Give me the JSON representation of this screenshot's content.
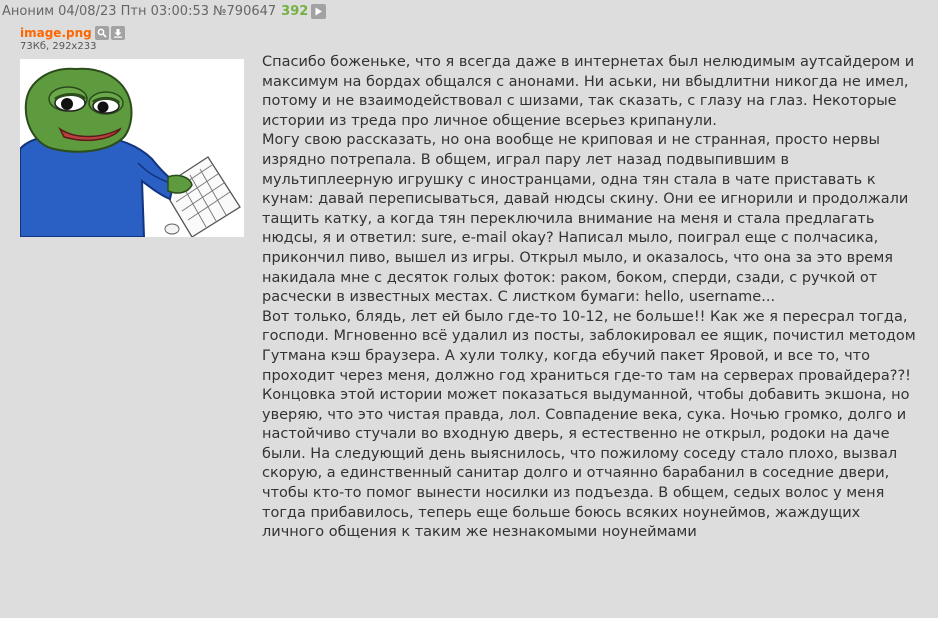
{
  "post": {
    "author": "Аноним",
    "date": "04/08/23 Птн 03:00:53",
    "number": "№790647",
    "replies": "392",
    "file": {
      "name": "image.png",
      "meta": "73Кб, 292x233",
      "thumb_alt": ""
    },
    "lines": [
      "Спасибо боженьке, что я всегда даже в интернетах был нелюдимым аутсайдером и",
      "максимум на бордах общался с анонами. Ни аськи, ни вбыдлитни никогда не имел,",
      "потому и не взаимодействовал с шизами, так сказать, с глазу на глаз. Некоторые",
      "истории из треда про личное общение всерьез крипанули.",
      "Могу свою рассказать, но она вообще не криповая и не странная, просто нервы",
      "изрядно потрепала. В общем, играл пару лет назад подвыпившим в",
      "мультиплеерную игрушку с иностранцами, одна тян стала в чате приставать к",
      "кунам: давай переписываться, давай нюдсы скину. Они ее игнорили и продолжали",
      "тащить катку, а когда тян переключила внимание на меня и стала предлагать",
      "нюдсы, я и ответил: sure, e-mail okay? Написал мыло, поиграл еще с полчасика,",
      "прикончил пиво, вышел из игры. Открыл мыло, и оказалось, что она за это время",
      "накидала мне с десяток голых фоток: раком, боком, сперди, сзади, с ручкой от",
      "расчески в известных местах. С листком бумаги: hello, username...",
      "Вот только, блядь, лет ей было где-то 10-12, не больше!! Как же я пересрал тогда,",
      "господи. Мгновенно всё удалил из посты, заблокировал ее ящик, почистил методом",
      "Гутмана кэш браузера. А хули толку, когда ебучий пакет Яровой, и все то, что",
      "проходит через меня, должно год храниться где-то там на серверах провайдера??!",
      "Концовка этой истории может показаться выдуманной, чтобы добавить экшона, но",
      "уверяю, что это чистая правда, лол. Совпадение века, сука. Ночью громко, долго и",
      "настойчиво стучали во входную дверь, я естественно не открыл, родоки на даче",
      "были. На следующий день выяснилось, что пожилому соседу стало плохо, вызвал",
      "скорую, а единственный санитар долго и отчаянно барабанил в соседние двери,",
      "чтобы кто-то помог вынести носилки из подъезда. В общем, седых волос у меня",
      "тогда прибавилось, теперь еще больше боюсь всяких ноунеймов, жаждущих",
      "личного общения к таким же незнакомыми ноунеймами"
    ]
  },
  "colors": {
    "background": "#dddddd",
    "text": "#333333",
    "filename": "#ff6600",
    "replies": "#75b045",
    "icon_button": "#a2a2a2"
  },
  "icons": {
    "play": "play-icon",
    "search": "search-icon",
    "download": "download-icon"
  }
}
